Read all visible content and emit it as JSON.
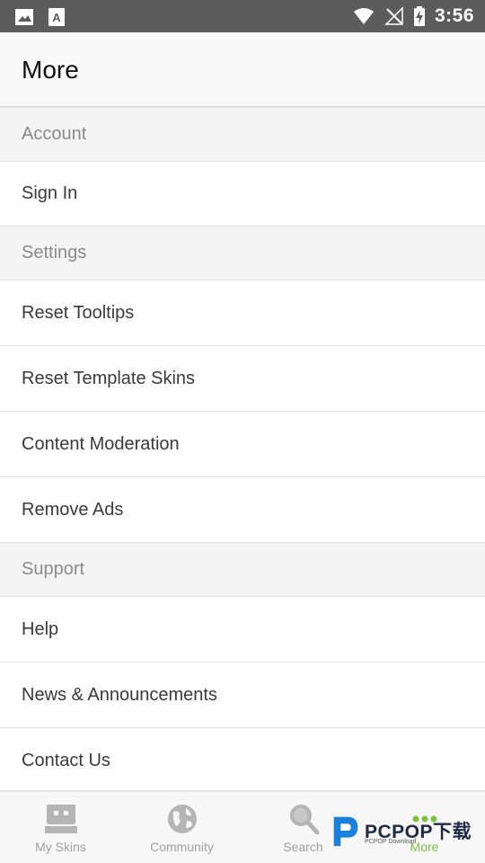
{
  "status_bar": {
    "time": "3:56",
    "left_icons": [
      "image-icon",
      "text-app-icon"
    ],
    "right_icons": [
      "wifi-icon",
      "no-signal-icon",
      "battery-charging-icon"
    ]
  },
  "header": {
    "title": "More"
  },
  "sections": {
    "account": {
      "title": "Account",
      "items": [
        {
          "label": "Sign In"
        }
      ]
    },
    "settings": {
      "title": "Settings",
      "items": [
        {
          "label": "Reset Tooltips"
        },
        {
          "label": "Reset Template Skins"
        },
        {
          "label": "Content Moderation"
        },
        {
          "label": "Remove Ads"
        }
      ]
    },
    "support": {
      "title": "Support",
      "items": [
        {
          "label": "Help"
        },
        {
          "label": "News & Announcements"
        },
        {
          "label": "Contact Us"
        }
      ]
    }
  },
  "bottom_nav": {
    "items": [
      {
        "label": "My Skins",
        "icon": "skin-icon",
        "active": false
      },
      {
        "label": "Community",
        "icon": "globe-icon",
        "active": false
      },
      {
        "label": "Search",
        "icon": "search-icon",
        "active": false
      },
      {
        "label": "More",
        "icon": "more-dots-icon",
        "active": true
      }
    ]
  },
  "watermark": {
    "text": "PCPOP下载",
    "subtext": "PCPOP Download"
  },
  "colors": {
    "status_bar": "#5c5c5c",
    "accent": "#7cc142",
    "section_header_text": "#8a8a8a",
    "item_text": "#3a3a3a",
    "nav_inactive": "#a0a0a0"
  }
}
